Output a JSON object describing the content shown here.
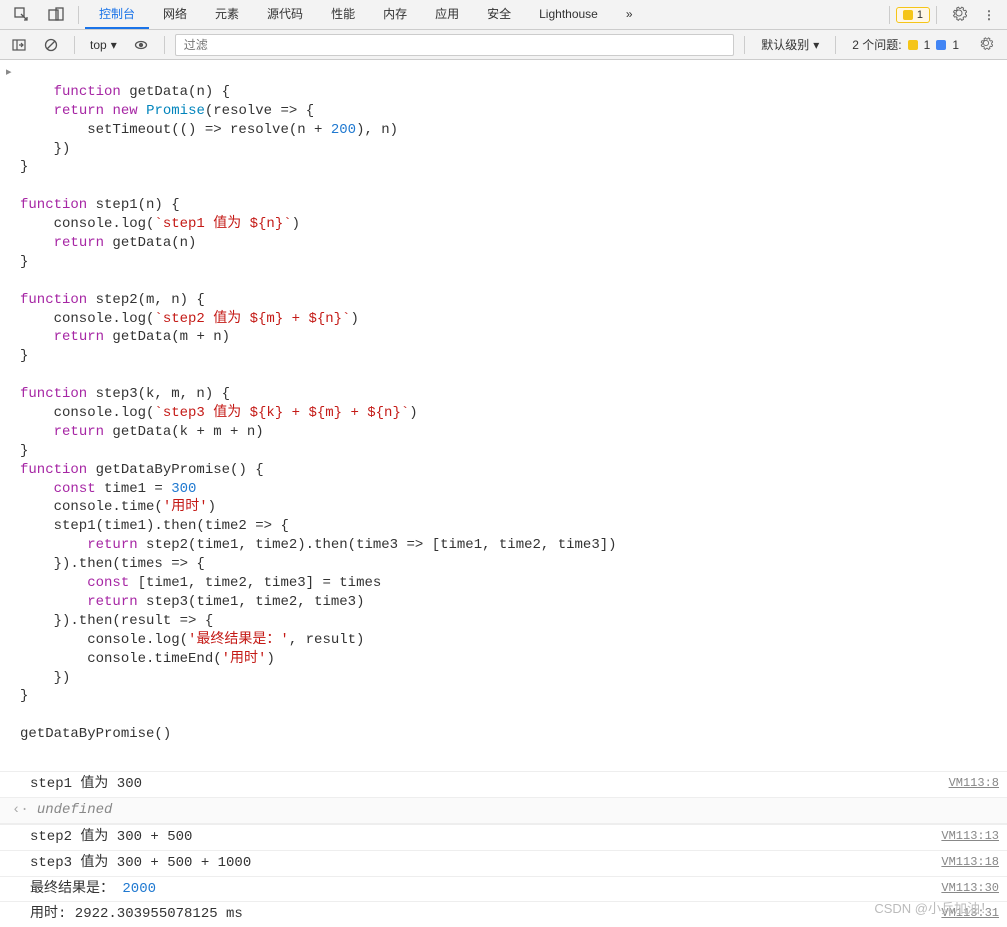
{
  "tabsBar": {
    "tabs": [
      "控制台",
      "网络",
      "元素",
      "源代码",
      "性能",
      "内存",
      "应用",
      "安全",
      "Lighthouse"
    ],
    "more": "»",
    "warnCount": "1"
  },
  "toolbar": {
    "context": "top",
    "filterPlaceholder": "过滤",
    "levelLabel": "默认级别",
    "issuesLabel": "2 个问题:",
    "issueWarn": "1",
    "issueInfo": "1"
  },
  "code": {
    "tokens": [
      {
        "t": "kw",
        "v": "function"
      },
      {
        "t": "bin",
        "v": " getData(n) {\n    "
      },
      {
        "t": "kw",
        "v": "return"
      },
      {
        "t": "bin",
        "v": " "
      },
      {
        "t": "new",
        "v": "new"
      },
      {
        "t": "bin",
        "v": " "
      },
      {
        "t": "cls",
        "v": "Promise"
      },
      {
        "t": "bin",
        "v": "(resolve => {\n        setTimeout(() => resolve(n + "
      },
      {
        "t": "num",
        "v": "200"
      },
      {
        "t": "bin",
        "v": "), n)\n    })\n}\n\n"
      },
      {
        "t": "kw",
        "v": "function"
      },
      {
        "t": "bin",
        "v": " step1(n) {\n    console.log("
      },
      {
        "t": "str",
        "v": "`step1 值为 ${n}`"
      },
      {
        "t": "bin",
        "v": ")\n    "
      },
      {
        "t": "kw",
        "v": "return"
      },
      {
        "t": "bin",
        "v": " getData(n)\n}\n\n"
      },
      {
        "t": "kw",
        "v": "function"
      },
      {
        "t": "bin",
        "v": " step2(m, n) {\n    console.log("
      },
      {
        "t": "str",
        "v": "`step2 值为 ${m} + ${n}`"
      },
      {
        "t": "bin",
        "v": ")\n    "
      },
      {
        "t": "kw",
        "v": "return"
      },
      {
        "t": "bin",
        "v": " getData(m + n)\n}\n\n"
      },
      {
        "t": "kw",
        "v": "function"
      },
      {
        "t": "bin",
        "v": " step3(k, m, n) {\n    console.log("
      },
      {
        "t": "str",
        "v": "`step3 值为 ${k} + ${m} + ${n}`"
      },
      {
        "t": "bin",
        "v": ")\n    "
      },
      {
        "t": "kw",
        "v": "return"
      },
      {
        "t": "bin",
        "v": " getData(k + m + n)\n}\n"
      },
      {
        "t": "kw",
        "v": "function"
      },
      {
        "t": "bin",
        "v": " getDataByPromise() {\n    "
      },
      {
        "t": "kw",
        "v": "const"
      },
      {
        "t": "bin",
        "v": " time1 = "
      },
      {
        "t": "num",
        "v": "300"
      },
      {
        "t": "bin",
        "v": "\n    console.time("
      },
      {
        "t": "str",
        "v": "'用时'"
      },
      {
        "t": "bin",
        "v": ")\n    step1(time1).then(time2 => {\n        "
      },
      {
        "t": "kw",
        "v": "return"
      },
      {
        "t": "bin",
        "v": " step2(time1, time2).then(time3 => [time1, time2, time3])\n    }).then(times => {\n        "
      },
      {
        "t": "kw",
        "v": "const"
      },
      {
        "t": "bin",
        "v": " [time1, time2, time3] = times\n        "
      },
      {
        "t": "kw",
        "v": "return"
      },
      {
        "t": "bin",
        "v": " step3(time1, time2, time3)\n    }).then(result => {\n        console.log("
      },
      {
        "t": "str",
        "v": "'最终结果是：'"
      },
      {
        "t": "bin",
        "v": ", result)\n        console.timeEnd("
      },
      {
        "t": "str",
        "v": "'用时'"
      },
      {
        "t": "bin",
        "v": ")\n    })\n}\n\ngetDataByPromise()"
      }
    ]
  },
  "output": [
    {
      "text": "step1 值为 300",
      "src": "VM113:8",
      "type": "log"
    },
    {
      "text": "undefined",
      "type": "return"
    },
    {
      "text": "step2 值为 300 + 500",
      "src": "VM113:13",
      "type": "log"
    },
    {
      "text": "step3 值为 300 + 500 + 1000",
      "src": "VM113:18",
      "type": "log"
    },
    {
      "textParts": [
        {
          "v": "最终结果是：  "
        },
        {
          "cls": "num",
          "v": "2000"
        }
      ],
      "src": "VM113:30",
      "type": "log"
    },
    {
      "text": "用时: 2922.303955078125 ms",
      "src": "VM113:31",
      "type": "log"
    }
  ],
  "watermark": "CSDN @小兵加油！"
}
